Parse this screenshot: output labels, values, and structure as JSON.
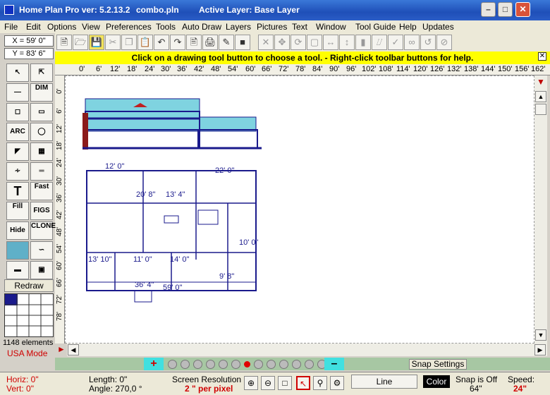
{
  "window": {
    "title": "Home Plan Pro ver: 5.2.13.2",
    "filename": "combo.pln",
    "active_layer": "Active Layer: Base Layer"
  },
  "menu": [
    "File",
    "Edit",
    "Options",
    "View",
    "Preferences",
    "Tools",
    "Auto Draw",
    "Layers",
    "Pictures",
    "Text",
    "Window",
    "Tool Guide",
    "Help",
    "Updates"
  ],
  "coords": {
    "x": "X = 59' 0\"",
    "y": "Y = 83' 6\""
  },
  "banner": "Click on a drawing tool button to choose a tool.  -  Right-click toolbar buttons for help.",
  "ruler_h": [
    "0'",
    "6'",
    "12'",
    "18'",
    "24'",
    "30'",
    "36'",
    "42'",
    "48'",
    "54'",
    "60'",
    "66'",
    "72'",
    "78'",
    "84'",
    "90'",
    "96'",
    "102'",
    "108'",
    "114'",
    "120'",
    "126'",
    "132'",
    "138'",
    "144'",
    "150'",
    "156'",
    "162'"
  ],
  "ruler_v": [
    "0'",
    "6'",
    "12'",
    "18'",
    "24'",
    "30'",
    "36'",
    "42'",
    "48'",
    "54'",
    "60'",
    "66'",
    "72'",
    "78'"
  ],
  "tools": {
    "dim": "DIM",
    "arc": "ARC",
    "fast": "Fast",
    "fill": "Fill",
    "figs": "FIGS",
    "hide": "Hide",
    "clone": "CLONE",
    "redraw": "Redraw"
  },
  "elements_count": "1148 elements",
  "mode": "USA Mode",
  "plan_dims": {
    "d1": "12' 0\"",
    "d2": "22' 0\"",
    "d3": "20' 8\"",
    "d4": "13' 4\"",
    "d5": "13' 10\"",
    "d6": "11' 0\"",
    "d7": "14' 0\"",
    "d8": "36' 4\"",
    "d9": "59' 0\"",
    "d10": "9' 8\"",
    "d11": "10' 0\""
  },
  "snap_settings": "Snap Settings",
  "status": {
    "horiz": "Horiz: 0\"",
    "vert": "Vert:  0\"",
    "length": "Length:  0\"",
    "angle": "Angle: 270,0 °",
    "screen_res_label": "Screen Resolution",
    "screen_res_value": "2 \" per pixel",
    "line": "Line",
    "color": "Color",
    "snap": "Snap is Off",
    "snap_val": "64\"",
    "speed": "Speed:",
    "speed_val": "24\""
  },
  "colors": {
    "plan": "#1a1a8c",
    "roof": "#7fd3e0",
    "banner": "#ffff00",
    "accent": "#d00000"
  }
}
